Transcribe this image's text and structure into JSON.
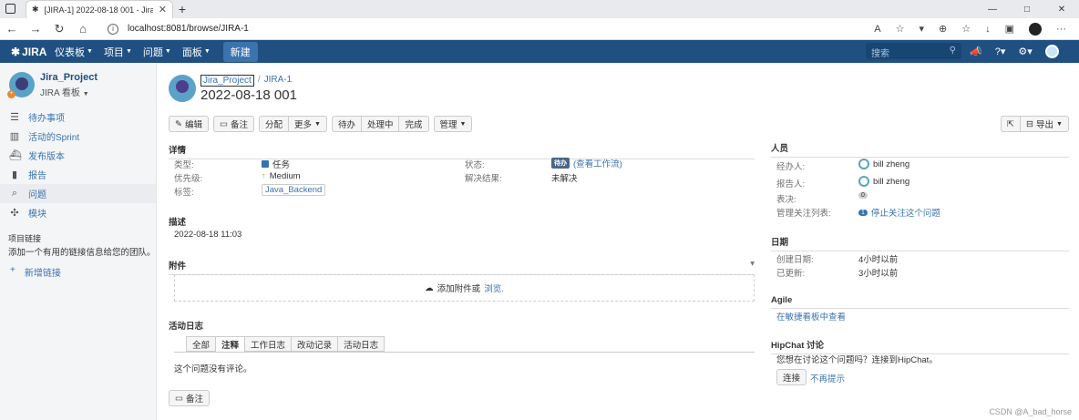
{
  "browser": {
    "tab_title": "[JIRA-1] 2022-08-18 001 - Jira lo",
    "url": "localhost:8081/browse/JIRA-1",
    "minimize": "—",
    "maximize": "□",
    "close": "✕"
  },
  "header": {
    "logo": "JIRA",
    "nav": [
      "仪表板",
      "项目",
      "问题",
      "面板"
    ],
    "create": "新建",
    "search_placeholder": "搜索"
  },
  "sidebar": {
    "project_name": "Jira_Project",
    "project_type": "JIRA 看板",
    "badge": "+",
    "items": [
      {
        "label": "待办事项"
      },
      {
        "label": "活动的Sprint"
      },
      {
        "label": "发布版本"
      },
      {
        "label": "报告"
      },
      {
        "label": "问题"
      },
      {
        "label": "模块"
      }
    ],
    "project_links_title": "项目链接",
    "project_links_desc": "添加一个有用的链接信息给您的团队。",
    "add_link": "新增链接"
  },
  "issue": {
    "breadcrumb_project": "Jira_Project",
    "breadcrumb_sep": "/",
    "breadcrumb_key": "JIRA-1",
    "summary": "2022-08-18 001"
  },
  "toolbar": {
    "edit": "编辑",
    "comment": "备注",
    "assign": "分配",
    "more": "更多",
    "todo": "待办",
    "in_progress": "处理中",
    "done": "完成",
    "admin": "管理",
    "export": "导出"
  },
  "details": {
    "title": "详情",
    "type_label": "类型:",
    "type_value": "任务",
    "priority_label": "优先级:",
    "priority_value": "Medium",
    "labels_label": "标签:",
    "labels_value": "Java_Backend",
    "status_label": "状态:",
    "status_value": "待办",
    "workflow_link": "(查看工作流)",
    "resolution_label": "解决结果:",
    "resolution_value": "未解决"
  },
  "description": {
    "title": "描述",
    "text": "2022-08-18 11:03"
  },
  "attachments": {
    "title": "附件",
    "drop_text": "添加附件或",
    "browse": "浏览."
  },
  "activity": {
    "title": "活动日志",
    "tabs": [
      "全部",
      "注释",
      "工作日志",
      "改动记录",
      "活动日志"
    ],
    "active_tab": "注释",
    "empty": "这个问题没有评论。",
    "comment_button": "备注"
  },
  "people": {
    "title": "人员",
    "assignee_label": "经办人:",
    "assignee": "bill zheng",
    "reporter_label": "报告人:",
    "reporter": "bill zheng",
    "votes_label": "表决:",
    "votes": "0",
    "watchers_label": "管理关注列表:",
    "watchers_count": "1",
    "watch_link": "停止关注这个问题"
  },
  "dates": {
    "title": "日期",
    "created_label": "创建日期:",
    "created": "4小时以前",
    "updated_label": "已更新:",
    "updated": "3小时以前"
  },
  "agile": {
    "title": "Agile",
    "link": "在敏捷看板中查看"
  },
  "hipchat": {
    "title": "HipChat 讨论",
    "text": "您想在讨论这个问题吗？连接到HipChat。",
    "connect": "连接",
    "dismiss": "不再提示"
  },
  "watermark": "CSDN @A_bad_horse"
}
